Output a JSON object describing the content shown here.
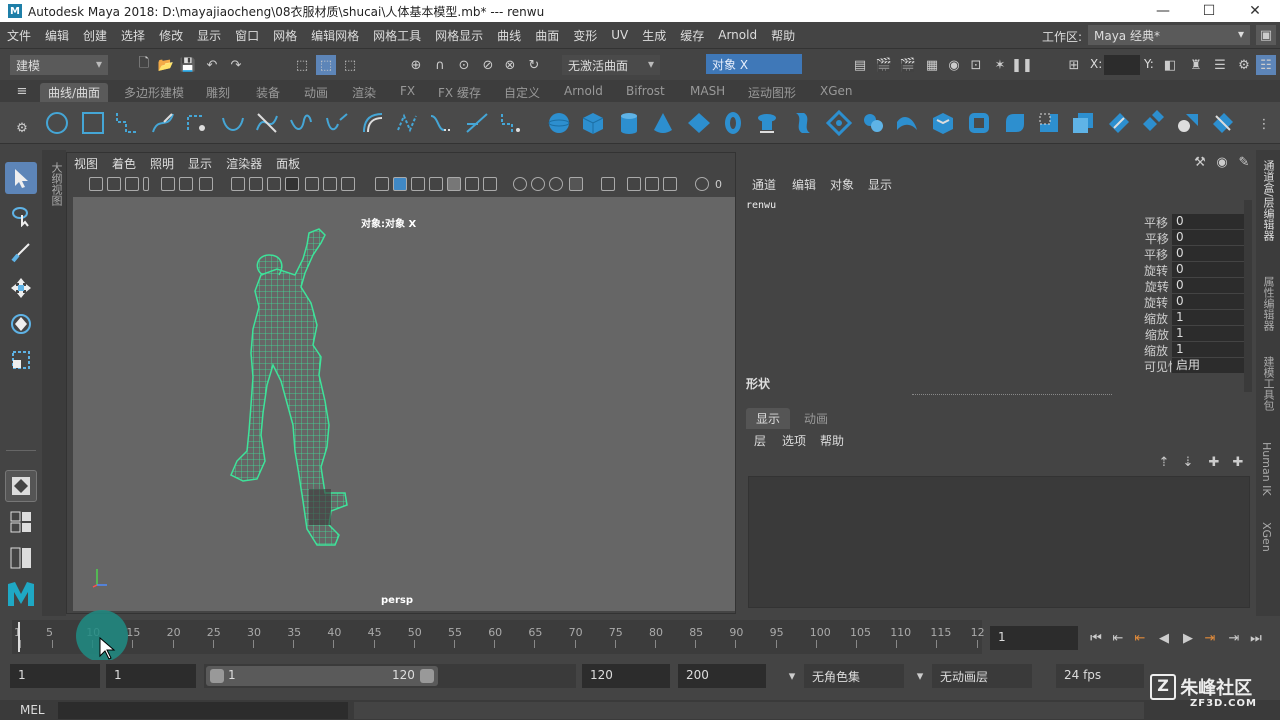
{
  "window": {
    "title": "Autodesk Maya 2018: D:\\mayajiaocheng\\08衣服材质\\shucai\\人体基本模型.mb*  ---  renwu",
    "logo": "M",
    "minimize": "—",
    "maximize": "☐",
    "close": "✕"
  },
  "menubar": {
    "items": [
      "文件",
      "编辑",
      "创建",
      "选择",
      "修改",
      "显示",
      "窗口",
      "网格",
      "编辑网格",
      "网格工具",
      "网格显示",
      "曲线",
      "曲面",
      "变形",
      "UV",
      "生成",
      "缓存",
      "Arnold",
      "帮助"
    ],
    "workspace_label": "工作区:",
    "workspace_value": "Maya 经典*"
  },
  "statusline": {
    "mode": "建模",
    "live_surface": "无激活曲面",
    "selection_mode": "对象 X",
    "x_label": "X:",
    "y_label": "Y:"
  },
  "shelf": {
    "tabs": [
      "曲线/曲面",
      "多边形建模",
      "雕刻",
      "装备",
      "动画",
      "渲染",
      "FX",
      "FX 缓存",
      "自定义",
      "Arnold",
      "Bifrost",
      "MASH",
      "运动图形",
      "XGen"
    ],
    "active_tab": "曲线/曲面"
  },
  "viewport": {
    "menu": [
      "视图",
      "着色",
      "照明",
      "显示",
      "渲染器",
      "面板"
    ],
    "object_label": "对象:对象 X",
    "camera": "persp",
    "icon_value": "0",
    "outliner_tab": "大纲视图"
  },
  "channel_box": {
    "menu": [
      "通道",
      "编辑",
      "对象",
      "显示"
    ],
    "object": "renwu",
    "attributes": [
      {
        "label": "平移 X",
        "value": "0"
      },
      {
        "label": "平移 Y",
        "value": "0"
      },
      {
        "label": "平移 Z",
        "value": "0"
      },
      {
        "label": "旋转 X",
        "value": "0"
      },
      {
        "label": "旋转 Y",
        "value": "0"
      },
      {
        "label": "旋转 Z",
        "value": "0"
      },
      {
        "label": "缩放 X",
        "value": "1"
      },
      {
        "label": "缩放 Y",
        "value": "1"
      },
      {
        "label": "缩放 Z",
        "value": "1"
      },
      {
        "label": "可见性",
        "value": "启用"
      }
    ],
    "shapes_label": "形状"
  },
  "layer_editor": {
    "tabs": [
      "显示",
      "动画"
    ],
    "menu": [
      "层",
      "选项",
      "帮助"
    ]
  },
  "right_tabs": [
    "通道盒/层编辑器",
    "属性编辑器",
    "建模工具包",
    "Human IK",
    "XGen"
  ],
  "timeline": {
    "ticks": [
      "1",
      "5",
      "10",
      "15",
      "20",
      "25",
      "30",
      "35",
      "40",
      "45",
      "50",
      "55",
      "60",
      "65",
      "70",
      "75",
      "80",
      "85",
      "90",
      "95",
      "100",
      "105",
      "110",
      "115",
      "12"
    ],
    "current_frame": "1"
  },
  "range": {
    "start": "1",
    "playback_start": "1",
    "slider_start": "1",
    "slider_end": "120",
    "playback_end": "120",
    "end": "200",
    "charset": "无角色集",
    "anim_layer": "无动画层",
    "fps": "24 fps"
  },
  "cmdline": {
    "label": "MEL"
  },
  "watermark": {
    "text": "朱峰社区",
    "sub": "ZF3D.COM"
  }
}
